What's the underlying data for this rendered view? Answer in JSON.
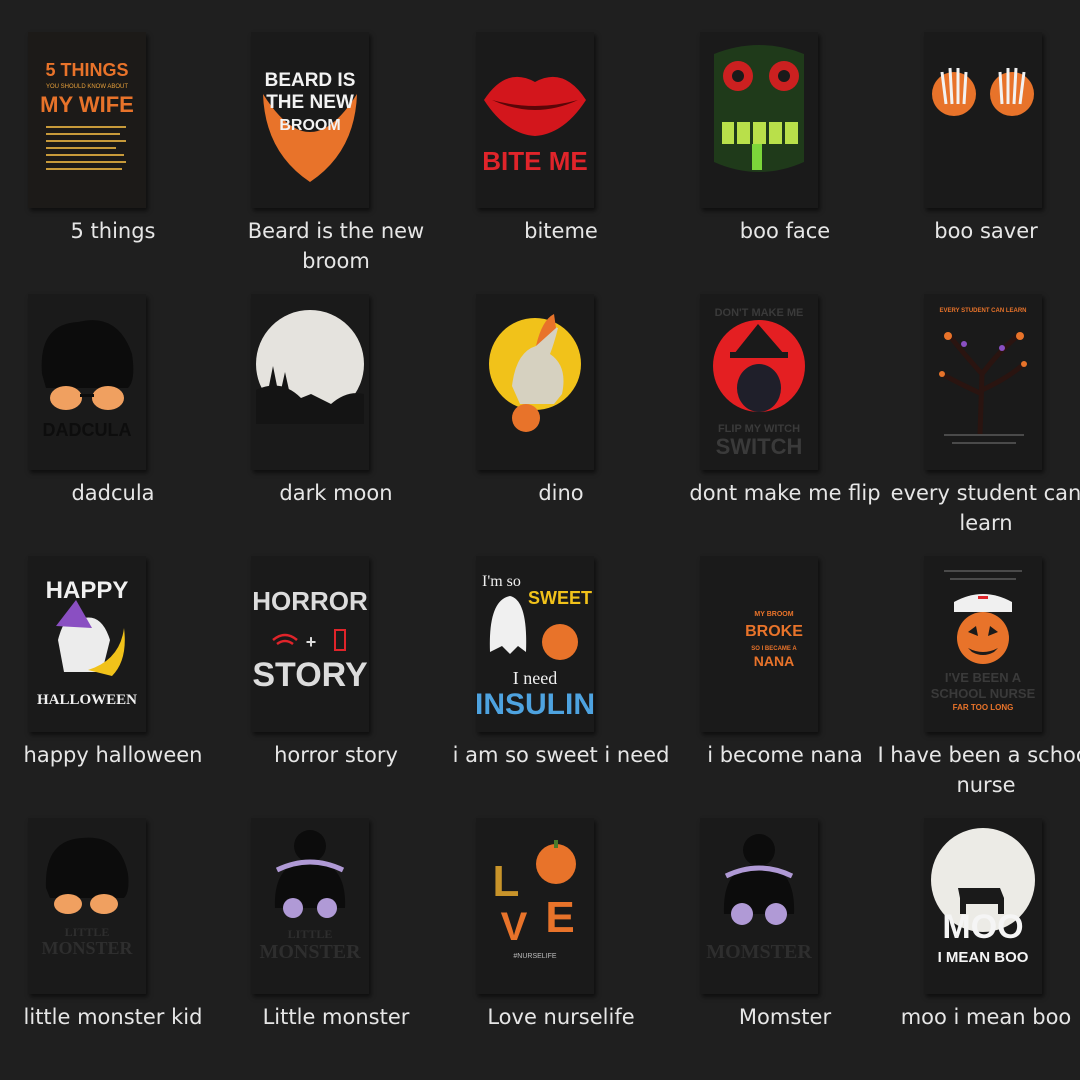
{
  "files": [
    {
      "name": "5 things",
      "thumb_text": [
        "5 THINGS",
        "YOU SHOULD KNOW ABOUT",
        "MY WIFE"
      ]
    },
    {
      "name": "Beard is the new broom",
      "thumb_text": [
        "BEARD IS",
        "THE NEW",
        "BROOM"
      ]
    },
    {
      "name": "biteme",
      "thumb_text": [
        "BITE ME"
      ]
    },
    {
      "name": "boo face",
      "thumb_text": []
    },
    {
      "name": "boo saver",
      "thumb_text": []
    },
    {
      "name": "dadcula",
      "thumb_text": [
        "DADCULA"
      ]
    },
    {
      "name": "dark moon",
      "thumb_text": []
    },
    {
      "name": "dino",
      "thumb_text": []
    },
    {
      "name": "dont make me flip",
      "thumb_text": [
        "DON'T MAKE ME",
        "FLIP MY WITCH",
        "SWITCH"
      ]
    },
    {
      "name": "every student can learn",
      "thumb_text": [
        "EVERY STUDENT CAN LEARN"
      ]
    },
    {
      "name": "happy halloween",
      "thumb_text": [
        "HAPPY",
        "HALLOWEEN"
      ]
    },
    {
      "name": "horror story",
      "thumb_text": [
        "HORROR",
        "STORY"
      ]
    },
    {
      "name": "i am so sweet i need",
      "thumb_text": [
        "I'm so",
        "SWEET",
        "I need",
        "INSULIN"
      ]
    },
    {
      "name": "i become nana",
      "thumb_text": [
        "MY BROOM",
        "BROKE",
        "SO I BECAME A",
        "NANA"
      ]
    },
    {
      "name": "I have been a school nurse",
      "thumb_text": [
        "I'VE BEEN A",
        "SCHOOL NURSE",
        "FAR TOO LONG"
      ]
    },
    {
      "name": "little monster kid",
      "thumb_text": [
        "LITTLE",
        "MONSTER"
      ]
    },
    {
      "name": "Little monster",
      "thumb_text": [
        "LITTLE",
        "MONSTER"
      ]
    },
    {
      "name": "Love nurselife",
      "thumb_text": [
        "L",
        "V",
        "E",
        "#NURSELIFE"
      ]
    },
    {
      "name": "Momster",
      "thumb_text": [
        "MOMSTER"
      ]
    },
    {
      "name": "moo i mean boo",
      "thumb_text": [
        "MOO",
        "I MEAN BOO"
      ]
    }
  ],
  "colors": {
    "background": "#1f1f1f",
    "label": "#e6e6e6",
    "accent_orange": "#e8732a"
  }
}
